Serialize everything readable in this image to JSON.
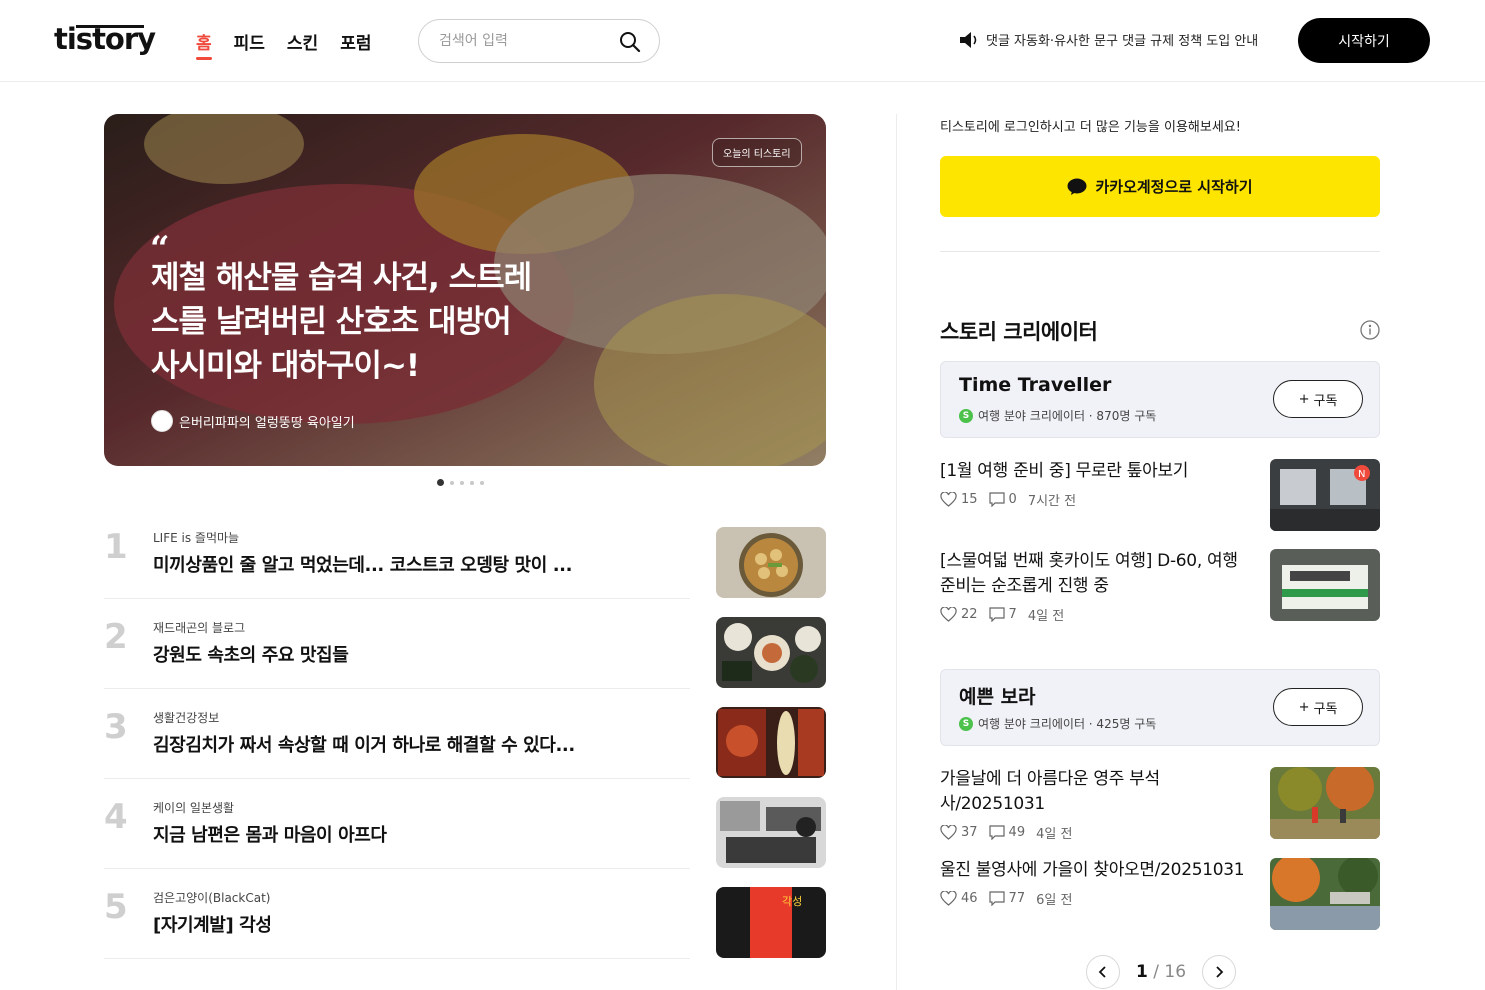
{
  "header": {
    "logo": "tistory",
    "nav": [
      "홈",
      "피드",
      "스킨",
      "포럼"
    ],
    "search_placeholder": "검색어 입력",
    "notice": "댓글 자동화·유사한 문구 댓글 규제 정책 도입 안내",
    "start_button": "시작하기"
  },
  "hero": {
    "badge": "오늘의 티스토리",
    "quote_mark": "“",
    "title": "제철 해산물 습격 사건, 스트레스를 날려버린 산호초 대방어 사시미와 대하구이~!",
    "author": "은버리파파의 얼렁뚱땅 육아일기",
    "slide_count": 5,
    "active_slide": 1
  },
  "ranking": [
    {
      "num": "1",
      "blog": "LIFE is 즐먹마늘",
      "title": "미끼상품인 줄 알고 먹었는데... 코스트코 오뎅탕 맛이 ..."
    },
    {
      "num": "2",
      "blog": "재드래곤의 블로그",
      "title": "강원도 속초의 주요 맛집들"
    },
    {
      "num": "3",
      "blog": "생활건강정보",
      "title": "김장김치가 짜서 속상할 때 이거 하나로 해결할 수 있다..."
    },
    {
      "num": "4",
      "blog": "케이의 일본생활",
      "title": "지금 남편은 몸과 마음이 아프다"
    },
    {
      "num": "5",
      "blog": "검은고양이(BlackCat)",
      "title": "[자기계발] 각성",
      "thumb_text": "각성"
    }
  ],
  "sidebar": {
    "login_message": "티스토리에 로그인하시고 더 많은 기능을 이용해보세요!",
    "kakao_button": "카카오계정으로 시작하기",
    "creator_heading": "스토리 크리에이터",
    "subscribe_label": "구독",
    "creators": [
      {
        "name": "Time Traveller",
        "badge": "S",
        "meta": "여행 분야 크리에이터 · 870명 구독",
        "posts": [
          {
            "title": "[1월 여행 준비 중] 무로란 톺아보기",
            "likes": "15",
            "comments": "0",
            "time": "7시간 전",
            "new_badge": "N"
          },
          {
            "title": "[스물여덟 번째 홋카이도 여행] D-60, 여행 준비는 순조롭게 진행 중",
            "likes": "22",
            "comments": "7",
            "time": "4일 전"
          }
        ]
      },
      {
        "name": "예쁜 보라",
        "badge": "S",
        "meta": "여행 분야 크리에이터 · 425명 구독",
        "posts": [
          {
            "title": "가을날에 더 아름다운 영주 부석사/20251031",
            "likes": "37",
            "comments": "49",
            "time": "4일 전"
          },
          {
            "title": "울진 불영사에 가을이 찾아오면/20251031",
            "likes": "46",
            "comments": "77",
            "time": "6일 전"
          }
        ]
      }
    ],
    "pager": {
      "current": "1",
      "total": "16"
    }
  },
  "colors": {
    "accent": "#ef4a3c",
    "kakao": "#fee500",
    "badge_green": "#4cc14c"
  }
}
